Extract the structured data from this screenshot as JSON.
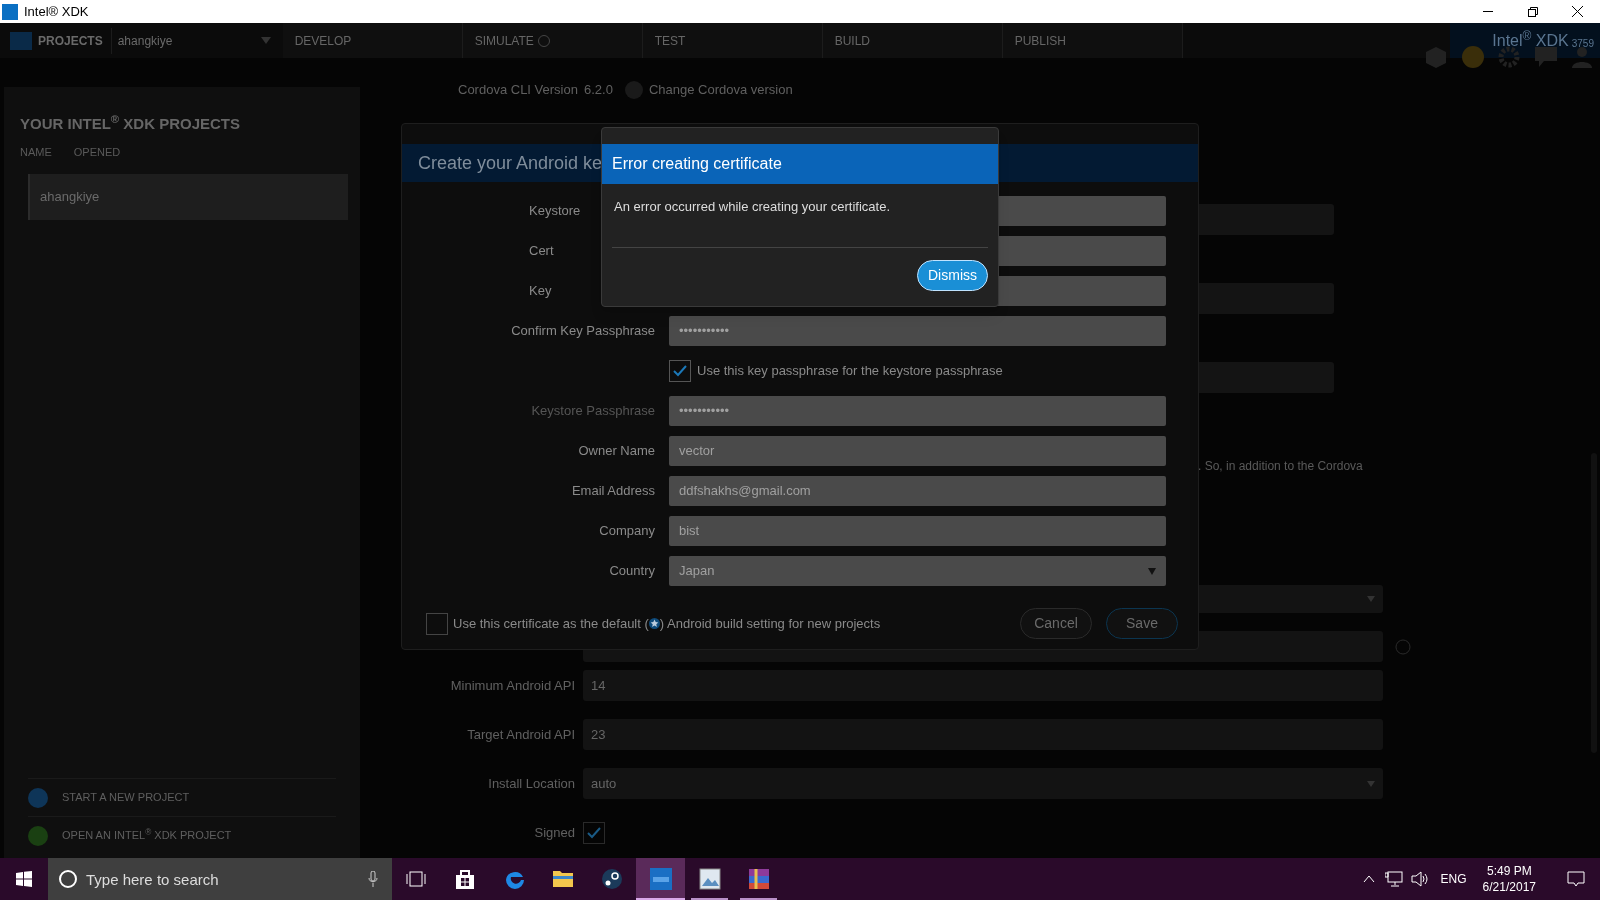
{
  "window": {
    "title": "Intel® XDK"
  },
  "nav": {
    "section": "PROJECTS",
    "project": "ahangkiye",
    "brand": "Intel$^{®}$ XDK",
    "version": "3759",
    "tabs": [
      {
        "label": "DEVELOP",
        "selected": false
      },
      {
        "label": "SIMULATE",
        "selected": false
      },
      {
        "label": "TEST",
        "selected": false
      },
      {
        "label": "BUILD",
        "selected": false
      },
      {
        "label": "PUBLISH",
        "selected": false
      }
    ]
  },
  "sidebar": {
    "heading": "YOUR INTEL$^{®}$ XDK PROJECTS",
    "columns": [
      "NAME",
      "OPENED"
    ],
    "projects": [
      {
        "name": "ahangkiye",
        "selected": true
      }
    ],
    "actions": [
      {
        "label": "START A NEW PROJECT",
        "kind": "new"
      },
      {
        "label": "OPEN AN INTEL$^{®}$ XDK PROJECT",
        "kind": "open"
      }
    ]
  },
  "build_settings": {
    "cordova_label": "Cordova CLI Version",
    "cordova_version": "6.2.0",
    "change_link": "Change Cordova version",
    "note": ". So, in addition to the Cordova",
    "rows": [
      {
        "label": "Minimum Android API",
        "value": "14",
        "kind": "text"
      },
      {
        "label": "Target Android API",
        "value": "23",
        "kind": "text"
      },
      {
        "label": "Install Location",
        "value": "auto",
        "kind": "select"
      },
      {
        "label": "Signed",
        "checked": true,
        "kind": "checkbox"
      }
    ]
  },
  "keystore_dialog": {
    "title": "Create your Android ke",
    "fields": [
      {
        "label": "Keystore",
        "kind": "text"
      },
      {
        "label": "Cert",
        "kind": "text"
      },
      {
        "label": "Key",
        "kind": "text"
      },
      {
        "label": "Confirm Key Passphrase",
        "value": "•••••••••••",
        "kind": "password"
      },
      {
        "label": "Use this key passphrase for the keystore passphrase",
        "checked": true,
        "kind": "checkbox"
      },
      {
        "label": "Keystore Passphrase",
        "value": "•••••••••••",
        "kind": "password",
        "disabled": true
      },
      {
        "label": "Owner Name",
        "value": "vector",
        "kind": "text"
      },
      {
        "label": "Email Address",
        "value": "ddfshakhs@gmail.com",
        "kind": "text"
      },
      {
        "label": "Company",
        "value": "bist",
        "kind": "text"
      },
      {
        "label": "Country",
        "value": "Japan",
        "kind": "select"
      }
    ],
    "default_option": {
      "checked": false,
      "before": "Use this certificate as the default (",
      "after": ") Android build setting for new projects"
    },
    "buttons": [
      "Cancel",
      "Save"
    ]
  },
  "error_dialog": {
    "title": "Error creating certificate",
    "message": "An error occurred while creating your certificate.",
    "button": "Dismiss"
  },
  "taskbar": {
    "search_placeholder": "Type here to search",
    "apps": [
      {
        "kind": "store",
        "active": false,
        "running": false
      },
      {
        "kind": "edge",
        "active": false,
        "running": false
      },
      {
        "kind": "explorer",
        "active": false,
        "running": false
      },
      {
        "kind": "steam",
        "active": false,
        "running": false
      },
      {
        "kind": "xdk",
        "active": true,
        "running": true
      },
      {
        "kind": "photo",
        "active": false,
        "running": true
      },
      {
        "kind": "archive",
        "active": false,
        "running": true
      }
    ],
    "language": "ENG",
    "time": "5:49 PM",
    "date": "6/21/2017"
  }
}
